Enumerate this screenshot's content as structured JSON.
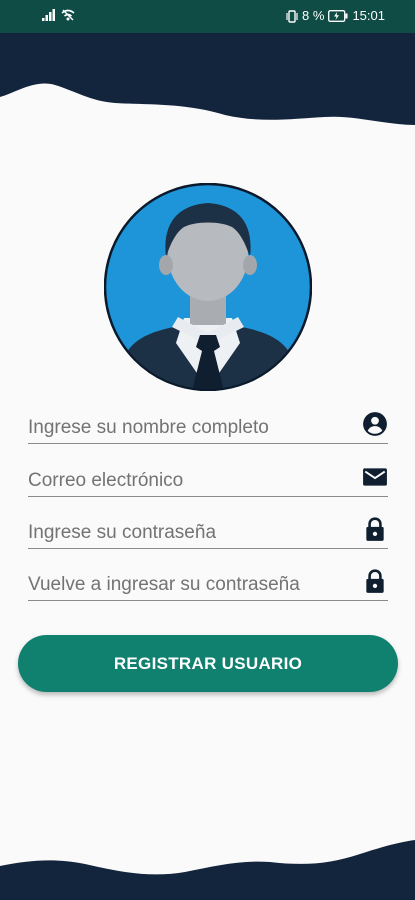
{
  "status_bar": {
    "battery_percent": "8 %",
    "time": "15:01"
  },
  "form": {
    "fields": [
      {
        "placeholder": "Ingrese su nombre completo",
        "icon": "account-circle-icon"
      },
      {
        "placeholder": "Correo electrónico",
        "icon": "mail-icon"
      },
      {
        "placeholder": "Ingrese su contraseña",
        "icon": "lock-icon"
      },
      {
        "placeholder": "Vuelve a ingresar su contraseña",
        "icon": "lock-icon"
      }
    ],
    "submit_label": "REGISTRAR USUARIO"
  },
  "colors": {
    "status_bar": "#0e4c45",
    "header_footer": "#13253d",
    "button": "#10806f",
    "avatar_circle": "#1e95d9"
  }
}
